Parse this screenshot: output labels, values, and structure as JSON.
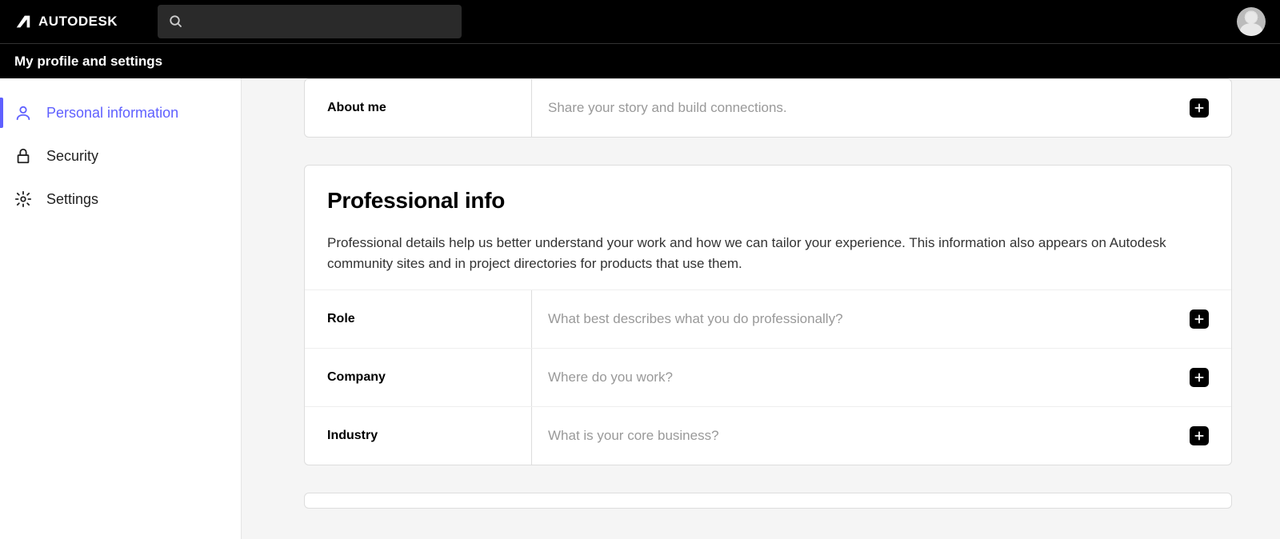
{
  "brand": "AUTODESK",
  "subheader": "My profile and settings",
  "sidebar": {
    "items": [
      {
        "label": "Personal information"
      },
      {
        "label": "Security"
      },
      {
        "label": "Settings"
      }
    ]
  },
  "about_me": {
    "label": "About me",
    "placeholder": "Share your story and build connections."
  },
  "professional": {
    "title": "Professional info",
    "description": "Professional details help us better understand your work and how we can tailor your experience. This information also appears on Autodesk community sites and in project directories for products that use them.",
    "rows": [
      {
        "label": "Role",
        "placeholder": "What best describes what you do professionally?"
      },
      {
        "label": "Company",
        "placeholder": "Where do you work?"
      },
      {
        "label": "Industry",
        "placeholder": "What is your core business?"
      }
    ]
  }
}
